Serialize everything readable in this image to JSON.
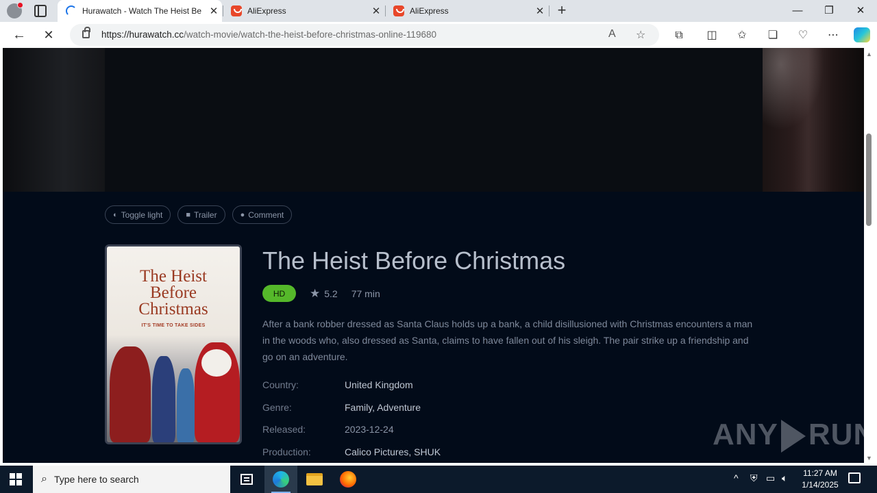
{
  "browser": {
    "tabs": [
      {
        "title": "Hurawatch - Watch The Heist Be",
        "favicon": "loading-spinner-icon",
        "active": true
      },
      {
        "title": "AliExpress",
        "favicon": "aliexpress-icon",
        "active": false
      },
      {
        "title": "AliExpress",
        "favicon": "aliexpress-icon",
        "active": false
      }
    ],
    "url_host": "https://hurawatch.cc",
    "url_path": "/watch-movie/watch-the-heist-before-christmas-online-119680"
  },
  "page": {
    "actions": [
      {
        "label": "Toggle light",
        "icon": "half-circle-icon"
      },
      {
        "label": "Trailer",
        "icon": "video-camera-icon"
      },
      {
        "label": "Comment",
        "icon": "comment-bubble-icon"
      }
    ],
    "poster": {
      "title_lines": [
        "The Heist",
        "Before",
        "Christmas"
      ],
      "tagline": "IT'S TIME TO TAKE SIDES"
    },
    "movie": {
      "title": "The Heist Before Christmas",
      "quality": "HD",
      "rating": "5.2",
      "duration": "77 min",
      "description": "After a bank robber dressed as Santa Claus holds up a bank, a child disillusioned with Christmas encounters a man in the woods who, also dressed as Santa, claims to have fallen out of his sleigh. The pair strike up a friendship and go on an adventure.",
      "facts": [
        {
          "label": "Country:",
          "value": "United Kingdom"
        },
        {
          "label": "Genre:",
          "value": "Family, Adventure"
        },
        {
          "label": "Released:",
          "value": "2023-12-24"
        },
        {
          "label": "Production:",
          "value": "Calico Pictures, SHUK"
        }
      ]
    },
    "watermark": {
      "left": "ANY",
      "right": "RUN"
    }
  },
  "taskbar": {
    "search_placeholder": "Type here to search",
    "time": "11:27 AM",
    "date": "1/14/2025"
  },
  "colors": {
    "page_bg": "#020b19",
    "hd_badge": "#55b82a",
    "title_text": "#b7bfcc"
  }
}
